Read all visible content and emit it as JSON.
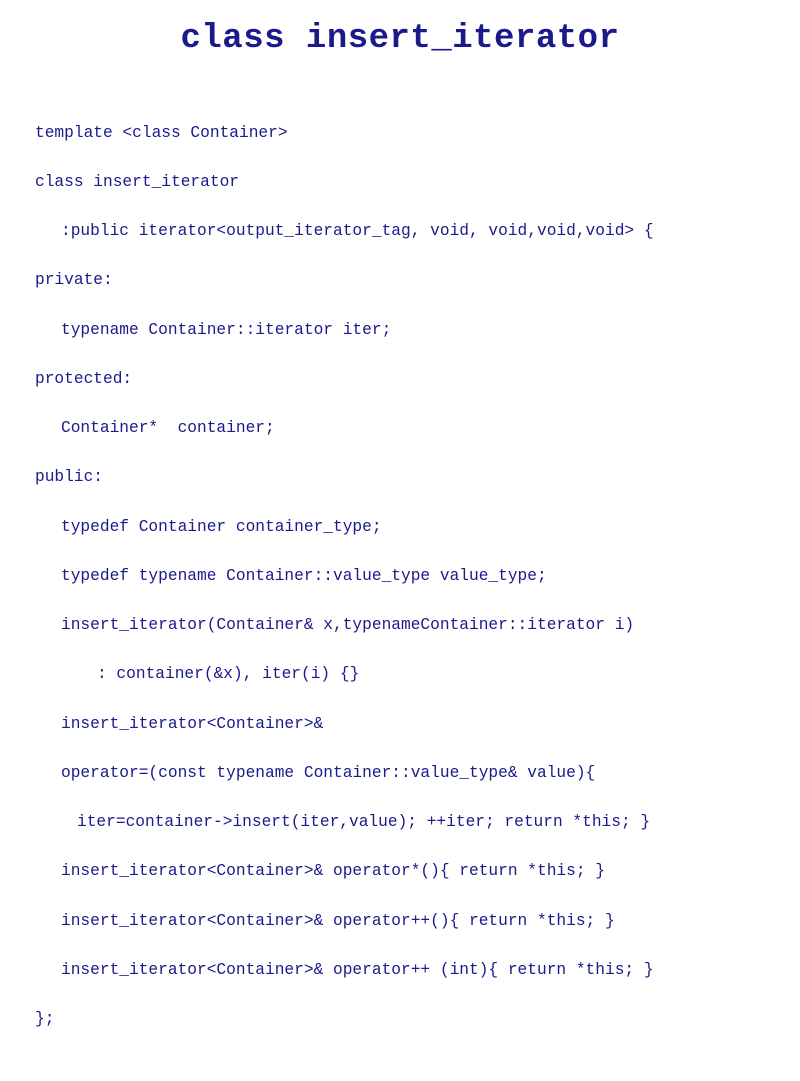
{
  "title": "class insert_iterator",
  "code": {
    "l1": "template <class Container>",
    "l2": "class insert_iterator",
    "l3": ":public iterator<output_iterator_tag, void, void,void,void> {",
    "l4": "private:",
    "l5": "typename Container::iterator iter;",
    "l6": "protected:",
    "l7": "Container*  container;",
    "l8": "public:",
    "l9": "typedef Container container_type;",
    "l10": "typedef typename Container::value_type value_type;",
    "l11": "insert_iterator(Container& x,typenameContainer::iterator i)",
    "l12": ": container(&x), iter(i) {}",
    "l13": "insert_iterator<Container>&",
    "l14": "operator=(const typename Container::value_type& value){",
    "l15": "iter=container->insert(iter,value); ++iter; return *this; }",
    "l16": "insert_iterator<Container>& operator*(){ return *this; }",
    "l17": "insert_iterator<Container>& operator++(){ return *this; }",
    "l18": "insert_iterator<Container>& operator++ (int){ return *this; }",
    "l19": "};"
  }
}
